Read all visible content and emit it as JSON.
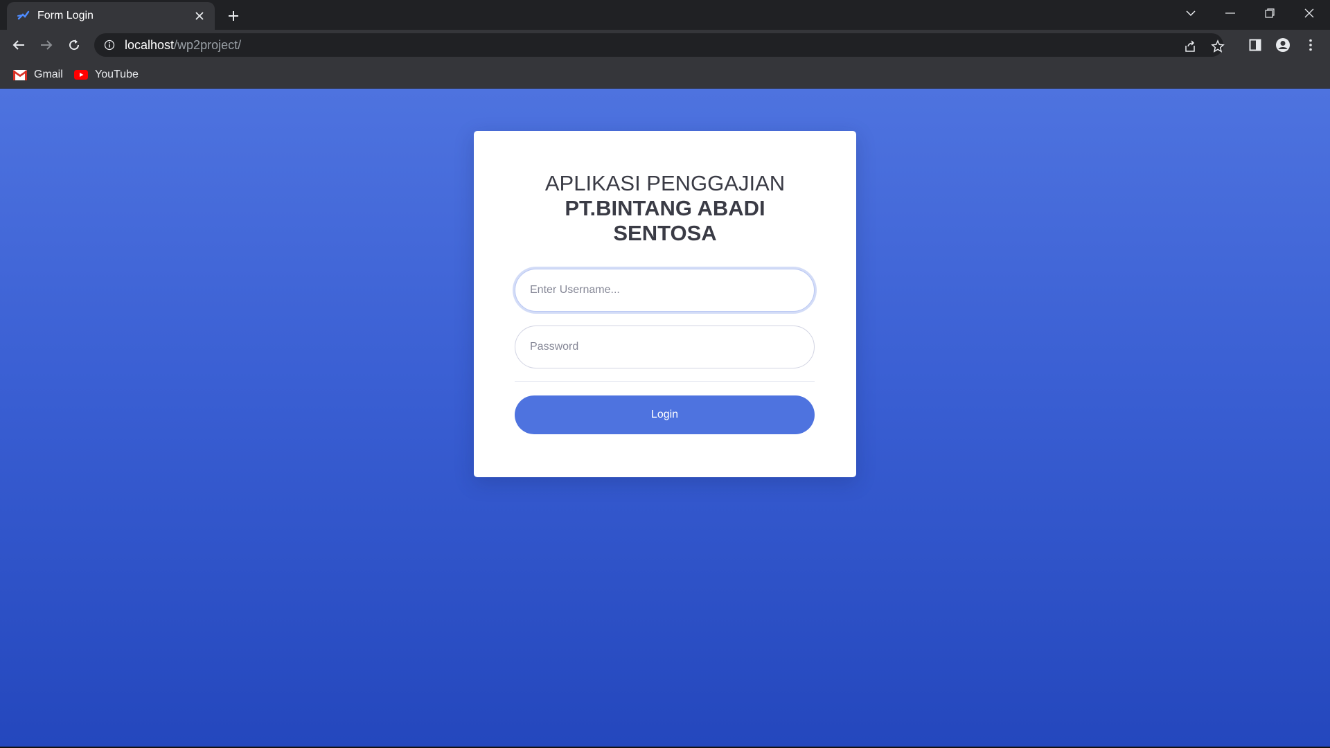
{
  "browser": {
    "tab_title": "Form Login",
    "url_host": "localhost",
    "url_path": "/wp2project/",
    "bookmarks": [
      {
        "label": "Gmail",
        "icon": "gmail-icon"
      },
      {
        "label": "YouTube",
        "icon": "youtube-icon"
      }
    ]
  },
  "login": {
    "heading_line1": "APLIKASI PENGGAJIAN",
    "heading_line2": "PT.BINTANG ABADI SENTOSA",
    "username_placeholder": "Enter Username...",
    "username_value": "",
    "password_placeholder": "Password",
    "password_value": "",
    "button_label": "Login"
  },
  "colors": {
    "primary": "#4e73df",
    "background_top": "#4e73df",
    "background_bottom": "#2447bd",
    "heading_text": "#3a3b45"
  }
}
